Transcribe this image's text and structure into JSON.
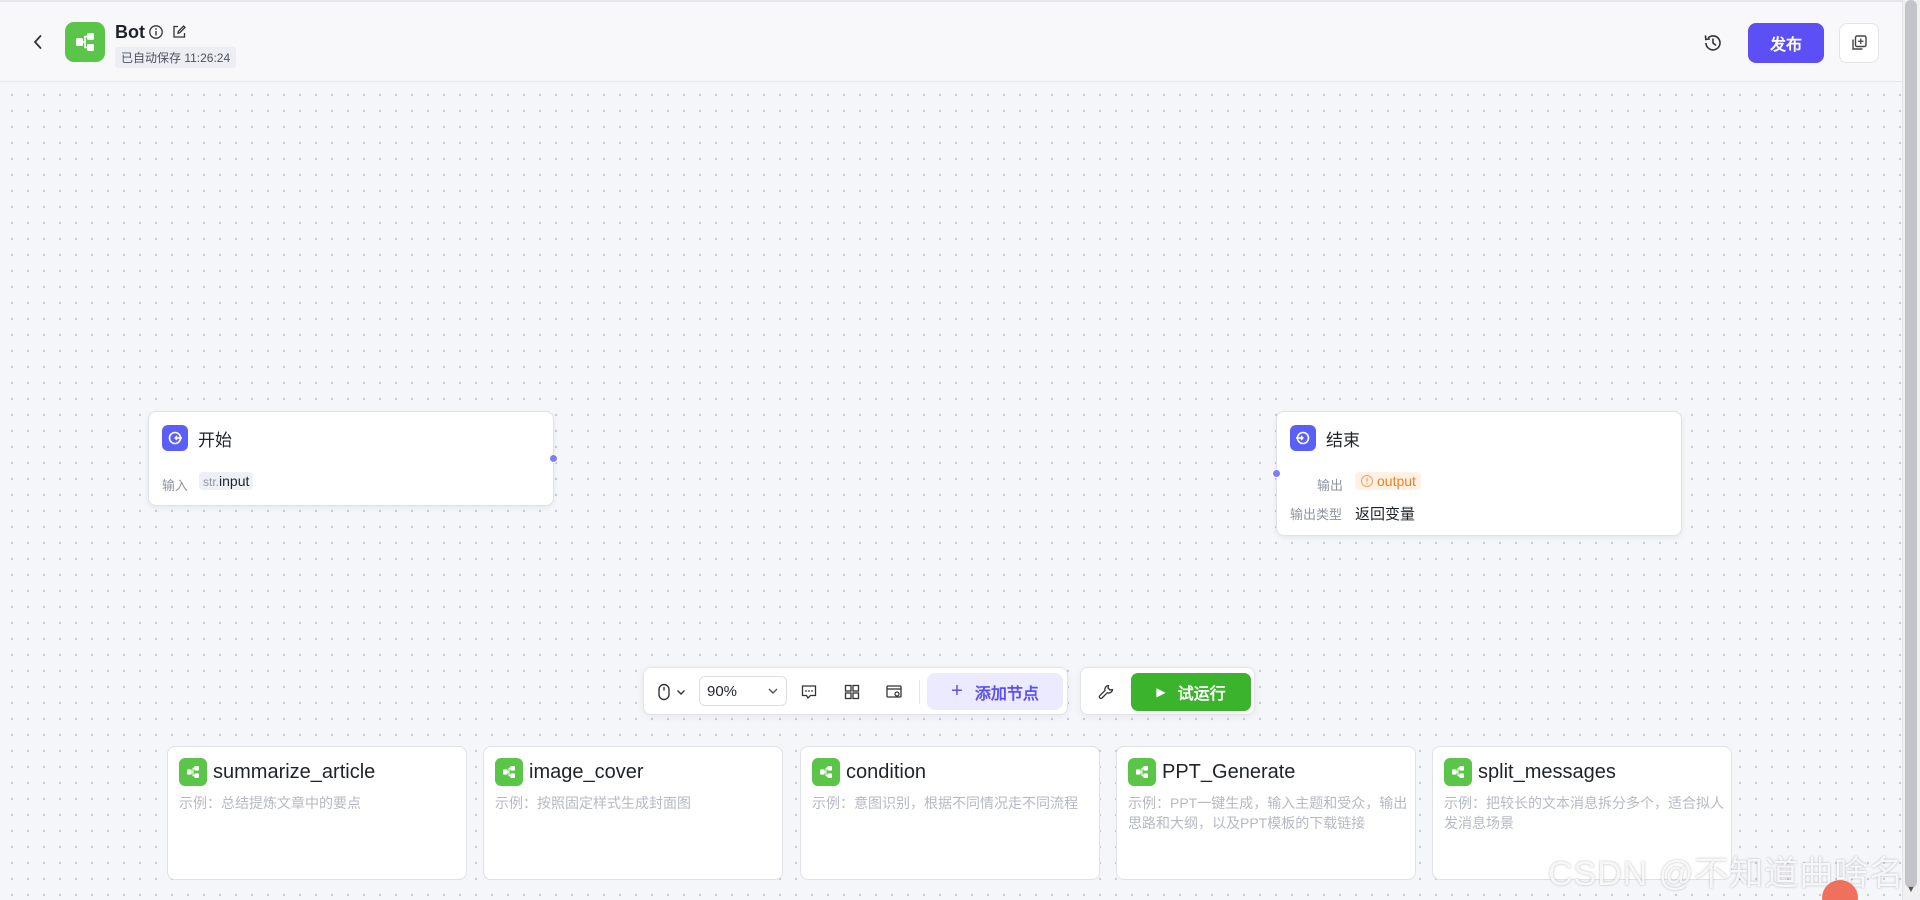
{
  "header": {
    "title": "Bot",
    "autosave": "已自动保存 11:26:24",
    "publish_label": "发布"
  },
  "nodes": {
    "start": {
      "title": "开始",
      "input_label": "输入",
      "input_type": "str.",
      "input_name": "input"
    },
    "end": {
      "title": "结束",
      "output_label": "输出",
      "output_name": "output",
      "output_type_label": "输出类型",
      "output_type_value": "返回变量"
    }
  },
  "toolbar": {
    "zoom": "90%",
    "add_node_label": "添加节点",
    "run_label": "试运行"
  },
  "templates": [
    {
      "title": "summarize_article",
      "desc": "示例：总结提炼文章中的要点"
    },
    {
      "title": "image_cover",
      "desc": "示例：按照固定样式生成封面图"
    },
    {
      "title": "condition",
      "desc": "示例：意图识别，根据不同情况走不同流程"
    },
    {
      "title": "PPT_Generate",
      "desc": "示例：PPT一键生成，输入主题和受众，输出思路和大纲，以及PPT模板的下载链接"
    },
    {
      "title": "split_messages",
      "desc": "示例：把较长的文本消息拆分多个，适合拟人发消息场景"
    }
  ],
  "watermark": "CSDN @不知道曲啥名",
  "colors": {
    "accent": "#5b4ff5",
    "run": "#3cb32c",
    "template_icon": "#5ac549",
    "output_tag": "#f07f21"
  },
  "icons": {
    "back": "chevron-left-icon",
    "info": "info-icon",
    "edit": "edit-icon",
    "history": "history-icon",
    "copy": "copy-icon",
    "mouse": "mouse-icon",
    "comment": "comment-icon",
    "layout": "layout-icon",
    "minimap": "minimap-icon",
    "wrench": "wrench-icon",
    "play": "play-icon"
  }
}
